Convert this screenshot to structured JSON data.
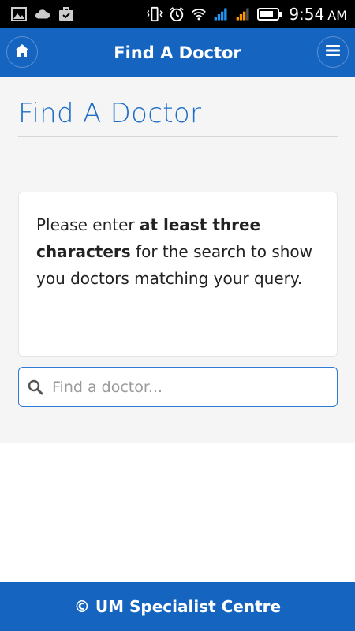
{
  "status_bar": {
    "time": "9:54",
    "ampm": "AM",
    "icons": [
      "image-icon",
      "cloud-icon",
      "briefcase-icon",
      "vibrate-icon",
      "alarm-icon",
      "wifi-icon",
      "signal-icon",
      "signal-icon",
      "battery-icon"
    ]
  },
  "navbar": {
    "title": "Find A Doctor",
    "home_icon": "home-icon",
    "menu_icon": "hamburger-menu-icon"
  },
  "page": {
    "heading": "Find A Doctor",
    "info": {
      "prefix": "Please enter ",
      "bold": "at least three characters",
      "suffix": " for the search to show you doctors matching your query."
    },
    "search": {
      "placeholder": "Find a doctor...",
      "value": ""
    }
  },
  "footer": {
    "text": "© UM Specialist Centre"
  },
  "colors": {
    "primary": "#1565c0",
    "heading": "#1e6ec8",
    "content_bg": "#f5f5f5",
    "status_bar": "#000000",
    "signal_blue": "#2196f3",
    "signal_orange": "#ff9800"
  }
}
